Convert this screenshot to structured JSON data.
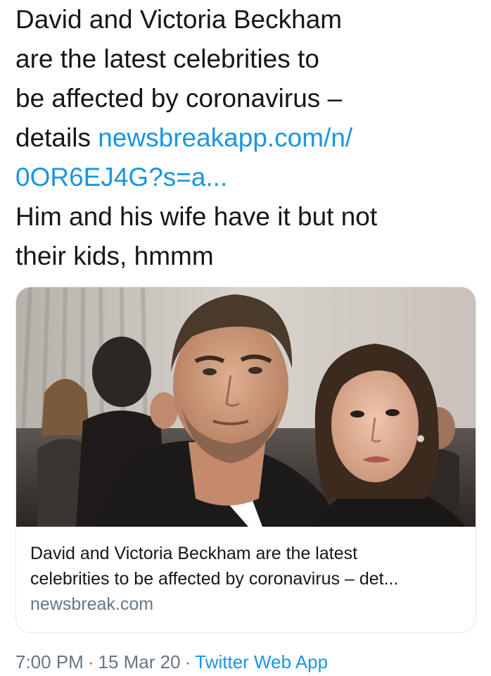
{
  "tweet": {
    "text_lines": [
      "David and Victoria Beckham",
      "are the latest celebrities to",
      "be affected by coronavirus –"
    ],
    "line4_prefix": "details ",
    "link_line1": "newsbreakapp.com/n/",
    "link_line2": "0OR6EJ4G?s=a...",
    "comment_lines": [
      "Him and his wife have it but not",
      "their kids,  hmmm"
    ]
  },
  "card": {
    "title_lines": [
      "David and Victoria Beckham are the latest",
      "celebrities to be affected by coronavirus – det..."
    ],
    "domain": "newsbreak.com"
  },
  "meta": {
    "time": "7:00 PM",
    "separator": "·",
    "date": "15 Mar 20",
    "source": "Twitter Web App"
  },
  "colors": {
    "link": "#1b95e0",
    "secondary_text": "#657786",
    "card_border": "#e1e8ed"
  }
}
